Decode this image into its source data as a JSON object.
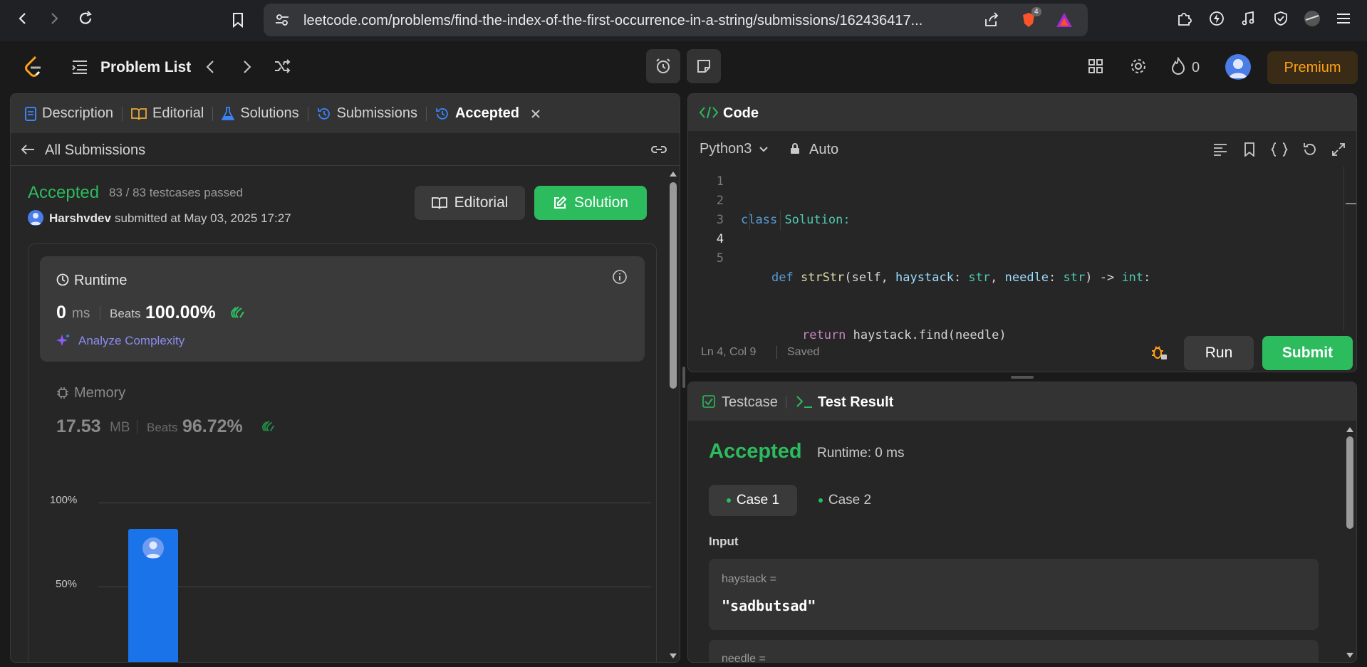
{
  "browser": {
    "url": "leetcode.com/problems/find-the-index-of-the-first-occurrence-in-a-string/submissions/162436417...",
    "brave_badge": "4"
  },
  "appbar": {
    "problem_list": "Problem List",
    "streak_count": "0",
    "premium": "Premium"
  },
  "left_tabs": [
    {
      "label": "Description"
    },
    {
      "label": "Editorial"
    },
    {
      "label": "Solutions"
    },
    {
      "label": "Submissions"
    },
    {
      "label": "Accepted"
    }
  ],
  "submissions": {
    "all_label": "All Submissions",
    "status": "Accepted",
    "testcases": "83 / 83 testcases passed",
    "user": "Harshvdev",
    "submitted_at": "submitted at May 03, 2025 17:27",
    "editorial_btn": "Editorial",
    "solution_btn": "Solution"
  },
  "runtime": {
    "title": "Runtime",
    "value": "0",
    "unit": "ms",
    "beats_label": "Beats",
    "beats_value": "100.00%",
    "analyze": "Analyze Complexity"
  },
  "memory": {
    "title": "Memory",
    "value": "17.53",
    "unit": "MB",
    "beats_label": "Beats",
    "beats_value": "96.72%"
  },
  "chart": {
    "tick_100": "100%",
    "tick_50": "50%",
    "user_bar_percent": 85
  },
  "code_panel": {
    "title": "Code",
    "language": "Python3",
    "mode": "Auto",
    "lines": [
      {
        "num": "1"
      },
      {
        "num": "2"
      },
      {
        "num": "3"
      },
      {
        "num": "4"
      },
      {
        "num": "5"
      }
    ],
    "code_line1_kw": "class",
    "code_line1_name": "Solution:",
    "code_line2_def": "def",
    "code_line2_fn": "strStr",
    "code_line2_p1": "(self, ",
    "code_line2_haystack": "haystack",
    "code_line2_colon1": ": ",
    "code_line2_str1": "str",
    "code_line2_comma": ", ",
    "code_line2_needle": "needle",
    "code_line2_colon2": ": ",
    "code_line2_str2": "str",
    "code_line2_arrow": ") -> ",
    "code_line2_int": "int",
    "code_line2_end": ":",
    "code_line3_return": "return",
    "code_line3_rest": " haystack.find(needle)",
    "status_pos": "Ln 4, Col 9",
    "status_saved": "Saved",
    "run": "Run",
    "submit": "Submit"
  },
  "test_panel": {
    "tab_testcase": "Testcase",
    "tab_result": "Test Result",
    "status": "Accepted",
    "runtime": "Runtime: 0 ms",
    "case1": "Case 1",
    "case2": "Case 2",
    "input_label": "Input",
    "haystack_label": "haystack =",
    "haystack_value": "\"sadbutsad\"",
    "needle_label": "needle ="
  },
  "colors": {
    "accent_green": "#2cbb5d",
    "accent_blue": "#1a73e8",
    "premium_orange": "#ffa116"
  }
}
